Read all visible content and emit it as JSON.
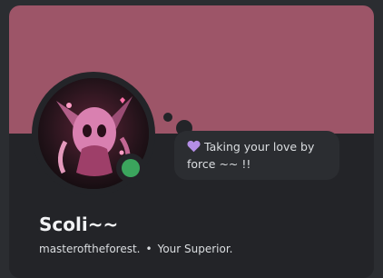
{
  "profile": {
    "display_name": "Scoli~~",
    "username": "masteroftheforest.",
    "separator": "•",
    "pronouns_or_tag": "Your Superior.",
    "status_color": "#3ba55d",
    "banner_color": "#9d5568"
  },
  "custom_status": {
    "emoji": "purple-heart-icon",
    "text": "Taking your love by force ~~ !!"
  }
}
